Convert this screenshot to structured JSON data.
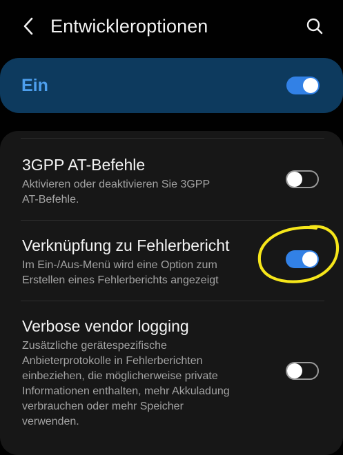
{
  "header": {
    "title": "Entwickleroptionen",
    "back_icon": "chevron-left-icon",
    "search_icon": "search-icon"
  },
  "master": {
    "label": "Ein",
    "toggle_on": true
  },
  "items": [
    {
      "title": "3GPP AT-Befehle",
      "subtitle_lines": [
        "Aktivieren oder deaktivieren Sie 3GPP",
        "AT-Befehle."
      ],
      "toggle_on": false
    },
    {
      "title": "Verknüpfung zu Fehlerbericht",
      "subtitle_lines": [
        "Im Ein-/Aus-Menü wird eine Option zum",
        "Erstellen eines Fehlerberichts angezeigt"
      ],
      "toggle_on": true
    },
    {
      "title": "Verbose vendor logging",
      "subtitle_lines": [
        "Zusätzliche gerätespezifische",
        "Anbieterprotokolle in Fehlerberichten",
        "einbeziehen, die möglicherweise private",
        "Informationen enthalten, mehr Akkuladung",
        "verbrauchen oder mehr Speicher",
        "verwenden."
      ],
      "toggle_on": false
    }
  ],
  "colors": {
    "background": "#010101",
    "master_bg": "#0d3a5e",
    "accent": "#3281e6",
    "annotation": "#f6e61a"
  }
}
